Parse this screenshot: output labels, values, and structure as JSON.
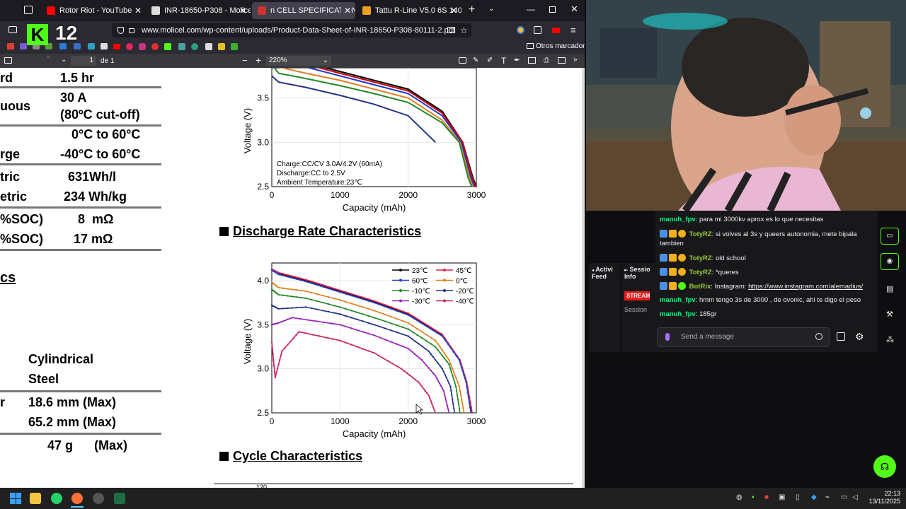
{
  "browser": {
    "tabs": [
      {
        "title": "Rotor Riot - YouTube",
        "favicon_color": "#ff0000"
      },
      {
        "title": "INR-18650-P308 - Molicel",
        "favicon_color": "#dddddd"
      },
      {
        "title": "n CELL SPECIFICATIONS - Produ",
        "favicon_color": "#cc3333"
      },
      {
        "title": "Tattu R-Line V5.0 6S 1400mAh",
        "favicon_color": "#f0a020"
      }
    ],
    "url": "www.molicel.com/wp-content/uploads/Product-Data-Sheet-of-INR-18650-P308-80111-2.pdf",
    "bookmarks_other": "Otros marcadores",
    "pdf": {
      "page_current": "1",
      "page_total": "de 1",
      "zoom": "220%"
    },
    "overlay_logo": "12"
  },
  "spec_table": {
    "rows": [
      {
        "label": "rd",
        "value": "1.5 hr"
      },
      {
        "label": "uous",
        "value": "30 A",
        "value2": "(80ºC cut-off)"
      },
      {
        "label": "",
        "value": "0°C to 60°C"
      },
      {
        "label": "rge",
        "value": "-40°C to 60°C"
      },
      {
        "label": "tric",
        "value": "631Wh/l"
      },
      {
        "label": "etric",
        "value": "234 Wh/kg"
      },
      {
        "label": "%SOC)",
        "value": "8  mΩ"
      },
      {
        "label": "%SOC)",
        "value": "17 mΩ"
      }
    ],
    "section_fragment": "cs",
    "shape_value": "Cylindrical",
    "case_value": "Steel",
    "diameter_label": "r",
    "diameter_value": "18.6 mm (Max)",
    "height_value": "65.2 mm (Max)",
    "weight_value": "47 g",
    "weight_max": "(Max)"
  },
  "charts": {
    "discharge_rate_title": "Discharge Rate Characteristics",
    "cycle_title": "Cycle Characteristics",
    "cycle_axis_fragment": "120"
  },
  "chart_data": [
    {
      "type": "line",
      "xlabel": "Capacity (mAh)",
      "ylabel": "Voltage (V)",
      "xlim": [
        0,
        3000
      ],
      "ylim": [
        2.5,
        4.0
      ],
      "xticks": [
        "0",
        "1000",
        "2000",
        "3000"
      ],
      "yticks": [
        "2.5",
        "3.0",
        "3.5",
        "4.0"
      ],
      "annotation": [
        "Charge:CC/CV 3.0A/4.2V (60mA)",
        "Discharge:CC to 2.5V",
        "Ambient Temperature:23℃"
      ],
      "series": [
        {
          "color": "#000000",
          "x": [
            0,
            100,
            500,
            1000,
            1500,
            2000,
            2500,
            2800,
            2950,
            3000
          ],
          "y": [
            4.0,
            3.97,
            3.9,
            3.8,
            3.7,
            3.6,
            3.35,
            3.0,
            2.6,
            2.5
          ]
        },
        {
          "color": "#cc0000",
          "x": [
            0,
            100,
            500,
            1000,
            1500,
            2000,
            2500,
            2800,
            2940,
            2990
          ],
          "y": [
            4.0,
            3.96,
            3.88,
            3.78,
            3.68,
            3.58,
            3.33,
            3.0,
            2.6,
            2.5
          ]
        },
        {
          "color": "#2233cc",
          "x": [
            0,
            100,
            500,
            1000,
            1500,
            2000,
            2500,
            2780,
            2920,
            2970
          ],
          "y": [
            4.0,
            3.93,
            3.85,
            3.75,
            3.65,
            3.55,
            3.3,
            3.0,
            2.6,
            2.5
          ]
        },
        {
          "color": "#e08020",
          "x": [
            0,
            100,
            500,
            1000,
            1500,
            2000,
            2500,
            2760,
            2900,
            2950
          ],
          "y": [
            3.95,
            3.85,
            3.78,
            3.7,
            3.6,
            3.5,
            3.25,
            3.0,
            2.6,
            2.5
          ]
        },
        {
          "color": "#22882a",
          "x": [
            0,
            100,
            500,
            1000,
            1500,
            2000,
            2500,
            2750,
            2880,
            2930
          ],
          "y": [
            3.88,
            3.78,
            3.72,
            3.64,
            3.55,
            3.45,
            3.22,
            3.0,
            2.6,
            2.5
          ]
        },
        {
          "color": "#223388",
          "x": [
            0,
            100,
            500,
            1000,
            1500,
            2000,
            2400
          ],
          "y": [
            3.75,
            3.68,
            3.62,
            3.53,
            3.43,
            3.3,
            3.0
          ]
        }
      ]
    },
    {
      "type": "line",
      "xlabel": "Capacity (mAh)",
      "ylabel": "Voltage (V)",
      "xlim": [
        0,
        3000
      ],
      "ylim": [
        2.5,
        4.2
      ],
      "xticks": [
        "0",
        "1000",
        "2000",
        "3000"
      ],
      "yticks": [
        "2.5",
        "3.0",
        "3.5",
        "4.0"
      ],
      "series": [
        {
          "name": "23℃",
          "color": "#000000",
          "x": [
            0,
            100,
            500,
            1000,
            1500,
            2000,
            2500,
            2750,
            2850,
            2930
          ],
          "y": [
            4.12,
            4.08,
            4.0,
            3.88,
            3.76,
            3.62,
            3.38,
            3.1,
            2.85,
            2.5
          ]
        },
        {
          "name": "45℃",
          "color": "#dd2244",
          "x": [
            0,
            100,
            500,
            1000,
            1500,
            2000,
            2500,
            2760,
            2860,
            2940
          ],
          "y": [
            4.13,
            4.09,
            4.01,
            3.89,
            3.77,
            3.63,
            3.39,
            3.1,
            2.85,
            2.5
          ]
        },
        {
          "name": "60℃",
          "color": "#2244cc",
          "x": [
            0,
            100,
            500,
            1000,
            1500,
            2000,
            2500,
            2750,
            2850,
            2920
          ],
          "y": [
            4.12,
            4.07,
            3.99,
            3.87,
            3.75,
            3.61,
            3.37,
            3.1,
            2.85,
            2.5
          ]
        },
        {
          "name": "0℃",
          "color": "#e08020",
          "x": [
            0,
            100,
            500,
            1000,
            1500,
            2000,
            2400,
            2600,
            2750,
            2820
          ],
          "y": [
            3.98,
            3.92,
            3.88,
            3.78,
            3.66,
            3.52,
            3.32,
            3.1,
            2.8,
            2.5
          ]
        },
        {
          "name": "-10℃",
          "color": "#22882a",
          "x": [
            0,
            100,
            500,
            1000,
            1500,
            2000,
            2400,
            2600,
            2700,
            2760
          ],
          "y": [
            3.9,
            3.84,
            3.8,
            3.7,
            3.58,
            3.45,
            3.25,
            3.05,
            2.8,
            2.5
          ]
        },
        {
          "name": "-20℃",
          "color": "#223388",
          "x": [
            0,
            100,
            500,
            1000,
            1500,
            2000,
            2300,
            2500,
            2620,
            2680
          ],
          "y": [
            3.72,
            3.68,
            3.7,
            3.62,
            3.5,
            3.37,
            3.2,
            3.0,
            2.8,
            2.5
          ]
        },
        {
          "name": "-30℃",
          "color": "#9922bb",
          "x": [
            0,
            100,
            300,
            1000,
            1500,
            2000,
            2200,
            2400,
            2520,
            2600
          ],
          "y": [
            3.5,
            3.52,
            3.58,
            3.5,
            3.38,
            3.23,
            3.1,
            2.92,
            2.75,
            2.5
          ]
        },
        {
          "name": "-40℃",
          "color": "#cc2266",
          "x": [
            0,
            50,
            150,
            400,
            1000,
            1500,
            1900,
            2150,
            2300,
            2400
          ],
          "y": [
            3.3,
            2.9,
            3.2,
            3.42,
            3.32,
            3.18,
            3.0,
            2.85,
            2.7,
            2.5
          ]
        }
      ]
    }
  ],
  "twitch": {
    "side_tabs": [
      {
        "label": "Activi Feed"
      },
      {
        "label": "Sessio Info"
      }
    ],
    "stream_badge": "STREAM",
    "session_label": "Session",
    "messages": [
      {
        "user": "manuh_fpv",
        "user_color": "#00ff7f",
        "text": "para mi 3000kv aprox es lo que necesitas",
        "badges": false
      },
      {
        "user": "TotyRZ",
        "user_color": "#9acd32",
        "text": "si volves al 3s y queers autonomia, mete bipala",
        "text2": "tambien",
        "badges": true
      },
      {
        "user": "TotyRZ",
        "user_color": "#9acd32",
        "text": "old school",
        "badges": true
      },
      {
        "user": "TotyRZ",
        "user_color": "#9acd32",
        "text": "*queres",
        "badges": true
      },
      {
        "user": "BotRix",
        "user_color": "#9acd32",
        "text": "Instagram:",
        "link": "https://www.instagram.com/alemadius/",
        "badges": true
      },
      {
        "user": "manuh_fpv",
        "user_color": "#00ff7f",
        "text": "hmm tengo 3s de 3000 , de ovonic, ahi te digo el peso",
        "badges": false
      },
      {
        "user": "manuh_fpv",
        "user_color": "#00ff7f",
        "text": "185gr",
        "badges": false
      }
    ],
    "input_placeholder": "Send a message"
  },
  "taskbar": {
    "time": "22:13",
    "date": "13/11/2025"
  }
}
